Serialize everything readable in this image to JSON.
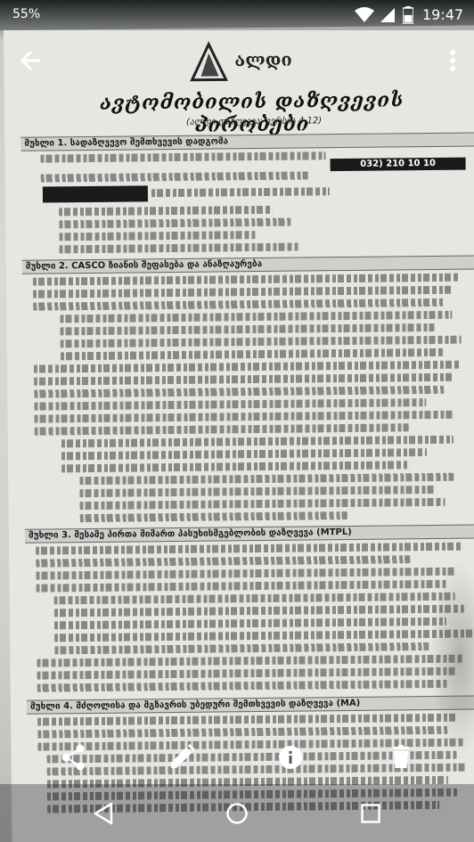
{
  "status_bar": {
    "battery_percent": "55%",
    "time": "19:47",
    "icons": [
      "wifi-icon",
      "signal-icon",
      "battery-icon"
    ]
  },
  "top_bar": {
    "icons": [
      "back-arrow-icon",
      "more-vert-icon"
    ]
  },
  "document": {
    "logo_text": "ალდი",
    "title": "ავტომობილის დაზღვევის პირობები",
    "subtitle": "(ალდი დაზღვევა: ვერსია 4.12)",
    "phone": "032) 210 10 10",
    "sections": [
      "მუხლი 1.   სადაზღვევო შემთხვევის დადგომა",
      "მუხლი 2.   CASCO ზიანის შეფასება და ანაზღაურება",
      "მუხლი 3.   მესამე პირთა მიმართ პასუხისმგებლობის დაზღვევა (MTPL)",
      "მუხლი 4.   მძღოლისა და მგზავრის უბედური შემთხვევის დაზღვევა (MA)"
    ]
  },
  "action_bar": {
    "icons": [
      "share-icon",
      "edit-icon",
      "info-icon",
      "delete-icon"
    ]
  },
  "nav_bar": {
    "icons": [
      "nav-back-icon",
      "nav-home-icon",
      "nav-recents-icon"
    ]
  }
}
